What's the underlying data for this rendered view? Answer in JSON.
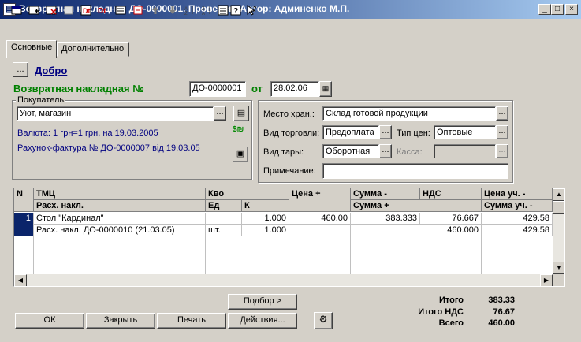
{
  "window": {
    "title": "Возвратная накладная ДО-0000001. Проведен. Автор: Админенко М.П.",
    "icon": "document-icon"
  },
  "tabs": [
    "Основные",
    "Дополнительно"
  ],
  "header": {
    "ellipsis": "...",
    "link": "Добро",
    "doc_label": "Возвратная накладная №",
    "doc_number": "ДО-0000001",
    "from_label": "от",
    "doc_date": "28.02.06"
  },
  "buyer": {
    "group_label": "Покупатель",
    "value": "Уют, магазин",
    "currency": "Валюта: 1 грн=1 грн, на 19.03.2005",
    "invoice": "Рахунок-фактура № ДО-0000007 від 19.03.05"
  },
  "right": {
    "store_label": "Место хран.:",
    "store_value": "Склад готовой продукции",
    "trade_label": "Вид торговли:",
    "trade_value": "Предоплата",
    "price_type_label": "Тип цен:",
    "price_type_value": "Оптовые",
    "tare_label": "Вид тары:",
    "tare_value": "Оборотная",
    "cash_label": "Касса:",
    "cash_value": "",
    "note_label": "Примечание:",
    "note_value": ""
  },
  "table": {
    "headers": {
      "n": "N",
      "tmc": "ТМЦ",
      "doc": "Расх. накл.",
      "qty": "Кво",
      "unit": "Ед",
      "k": "К",
      "price": "Цена +",
      "sum_minus": "Сумма -",
      "vat": "НДС",
      "sum_plus": "Сумма +",
      "price_acc_minus": "Цена уч. -",
      "sum_acc_minus": "Сумма уч. -"
    },
    "rows": [
      {
        "n": "1",
        "name": "Стол \"Кардинал\"",
        "qty": "1.000",
        "price": "460.00",
        "sum": "383.333",
        "vat": "76.667",
        "price_acc": "429.58"
      },
      {
        "n": "",
        "name": "Расх. накл. ДО-0000010 (21.03.05)",
        "unit": "шт.",
        "qty": "1.000",
        "sum_plus": "460.000",
        "sum_acc": "429.58"
      }
    ]
  },
  "buttons": {
    "select": "Подбор >",
    "ok": "ОК",
    "close": "Закрыть",
    "print": "Печать",
    "actions": "Действия..."
  },
  "totals": {
    "total_label": "Итого",
    "total_value": "383.33",
    "vat_label": "Итого НДС",
    "vat_value": "76.67",
    "all_label": "Всего",
    "all_value": "460.00"
  }
}
